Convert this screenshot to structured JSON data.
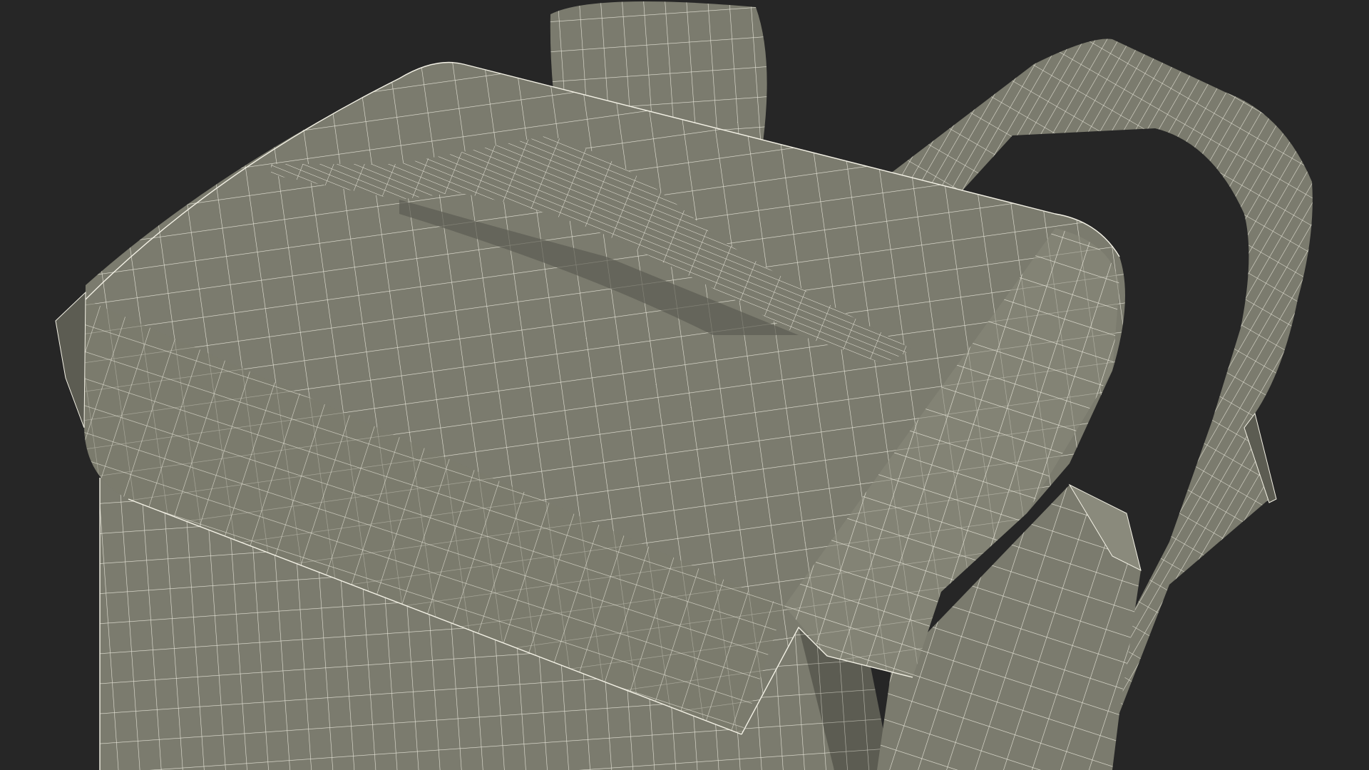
{
  "scene": {
    "subject": "backpack-wireframe",
    "colors": {
      "background": "#262626",
      "surface": "#7b7b6e",
      "surface_shadow": "#5c5c52",
      "surface_light": "#8a8a7c",
      "wire": "#f4f2e6"
    }
  }
}
